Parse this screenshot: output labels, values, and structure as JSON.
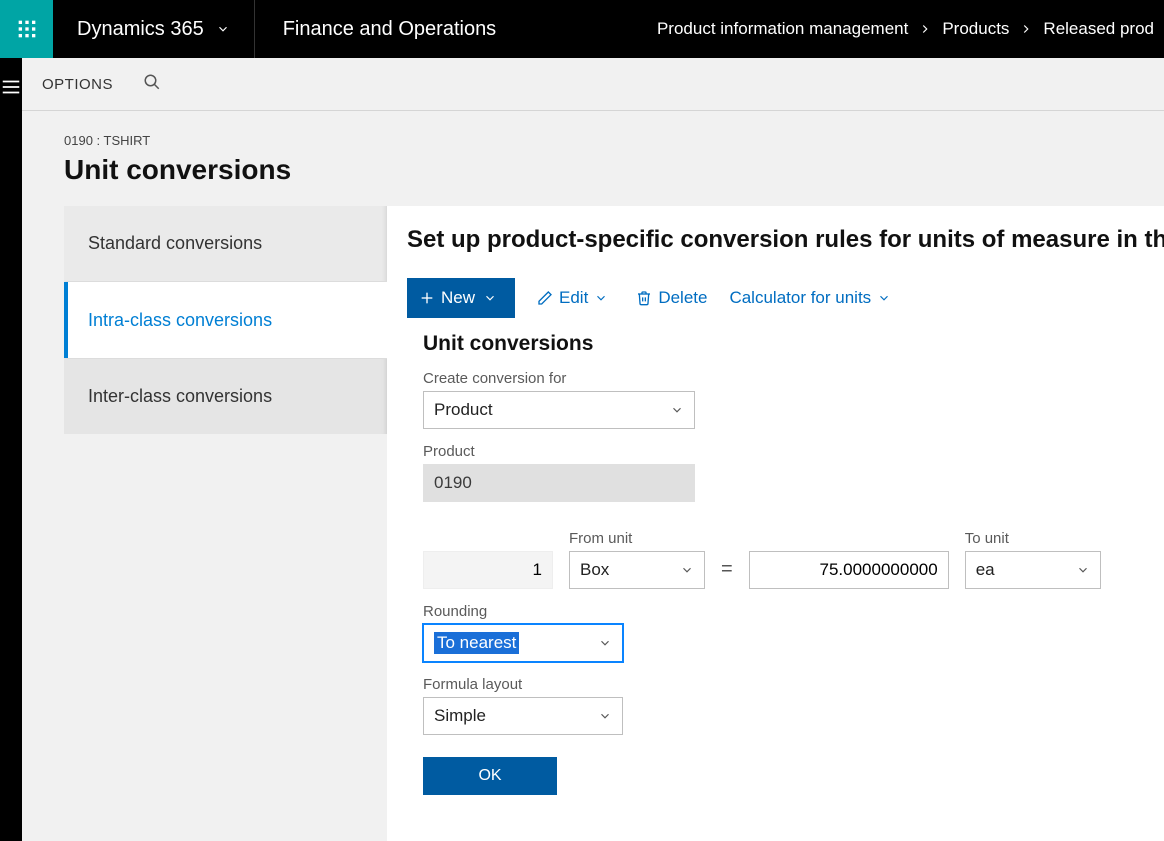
{
  "topbar": {
    "brand": "Dynamics 365",
    "module": "Finance and Operations",
    "breadcrumbs": [
      "Product information management",
      "Products",
      "Released prod"
    ]
  },
  "options_bar": {
    "label": "OPTIONS"
  },
  "header": {
    "context": "0190 : TSHIRT",
    "title": "Unit conversions"
  },
  "tabs": [
    {
      "label": "Standard conversions",
      "state": "inactive-top"
    },
    {
      "label": "Intra-class conversions",
      "state": "active"
    },
    {
      "label": "Inter-class conversions",
      "state": "inactive-bot"
    }
  ],
  "panel": {
    "heading": "Set up product-specific conversion rules for units of measure in the sam",
    "actions": {
      "new": "New",
      "edit": "Edit",
      "delete": "Delete",
      "calc": "Calculator for units"
    },
    "form": {
      "title": "Unit conversions",
      "create_for_label": "Create conversion for",
      "create_for_value": "Product",
      "product_label": "Product",
      "product_value": "0190",
      "factor_left": "1",
      "from_unit_label": "From unit",
      "from_unit_value": "Box",
      "factor_right": "75.0000000000",
      "to_unit_label": "To unit",
      "to_unit_value": "ea",
      "equals": "=",
      "rounding_label": "Rounding",
      "rounding_value": "To nearest",
      "formula_label": "Formula layout",
      "formula_value": "Simple",
      "ok": "OK"
    }
  }
}
